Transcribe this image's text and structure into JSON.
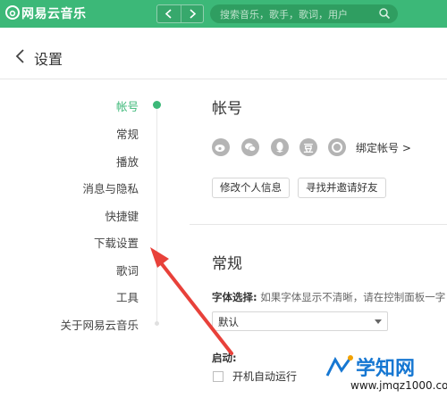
{
  "app": {
    "title": "网易云音乐"
  },
  "search": {
    "placeholder": "搜索音乐，歌手，歌词，用户"
  },
  "header": {
    "back_label": "<",
    "title": "设置"
  },
  "nav": {
    "items": [
      {
        "label": "帐号",
        "active": true
      },
      {
        "label": "常规"
      },
      {
        "label": "播放"
      },
      {
        "label": "消息与隐私"
      },
      {
        "label": "快捷键"
      },
      {
        "label": "下载设置"
      },
      {
        "label": "歌词"
      },
      {
        "label": "工具"
      },
      {
        "label": "关于网易云音乐"
      }
    ]
  },
  "account": {
    "title": "帐号",
    "social_icons": [
      "weibo-icon",
      "wechat-icon",
      "qq-icon",
      "douban-icon",
      "renren-icon"
    ],
    "bind_label": "绑定帐号 >",
    "edit_profile_label": "修改个人信息",
    "invite_label": "寻找并邀请好友"
  },
  "general": {
    "title": "常规",
    "font_label": "字体选择:",
    "font_hint": "如果字体显示不清晰，请在控制面板一字",
    "font_value": "默认",
    "startup_label": "启动:",
    "autostart_label": "开机自动运行"
  },
  "colors": {
    "brand_green": "#3cb878",
    "arrow_red": "#e8413a"
  },
  "watermark": {
    "main": "学知网",
    "sub": "www.jmqz1000.com"
  }
}
